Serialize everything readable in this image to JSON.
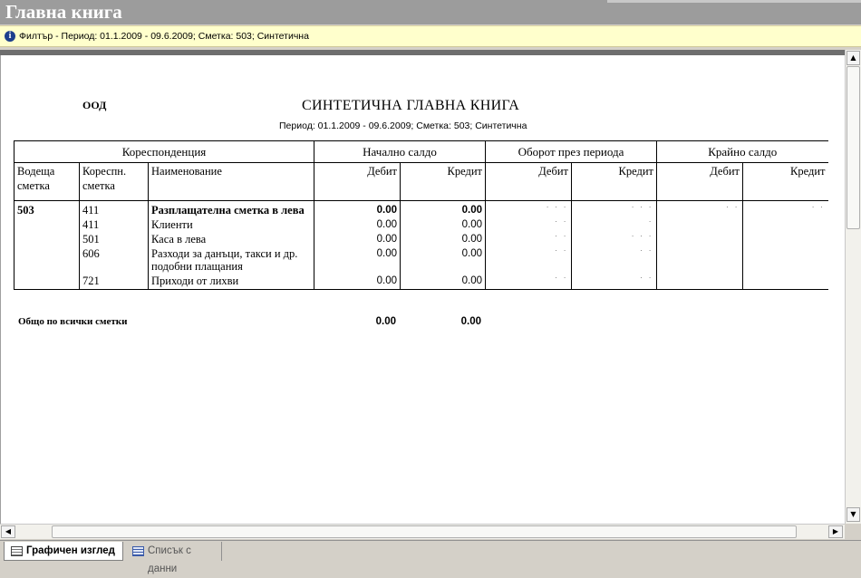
{
  "window": {
    "title": "Главна книга"
  },
  "filter": {
    "text": "Филтър - Период: 01.1.2009 - 09.6.2009; Сметка: 503; Синтетична"
  },
  "report": {
    "company": "ООД",
    "title": "СИНТЕТИЧНА ГЛАВНА КНИГА",
    "subtitle": "Период: 01.1.2009 - 09.6.2009; Сметка: 503; Синтетична",
    "group_headers": {
      "correspondence": "Кореспонденция",
      "opening_balance": "Начално салдо",
      "turnover": "Оборот през периода",
      "closing_balance": "Крайно салдо"
    },
    "columns": {
      "lead_account": "Водеща сметка",
      "corr_account": "Кореспн. сметка",
      "name": "Наименование",
      "debit": "Дебит",
      "credit": "Кредит"
    },
    "rows": [
      {
        "lead": "503",
        "corr": "411",
        "name": "Разплащателна сметка в лева",
        "bold": true,
        "open_debit": "0.00",
        "open_credit": "0.00"
      },
      {
        "lead": "",
        "corr": "411",
        "name": "Клиенти",
        "bold": false,
        "open_debit": "0.00",
        "open_credit": "0.00"
      },
      {
        "lead": "",
        "corr": "501",
        "name": "Каса в лева",
        "bold": false,
        "open_debit": "0.00",
        "open_credit": "0.00"
      },
      {
        "lead": "",
        "corr": "606",
        "name": "Разходи за данъци, такси и др. подобни плащания",
        "bold": false,
        "open_debit": "0.00",
        "open_credit": "0.00"
      },
      {
        "lead": "",
        "corr": "721",
        "name": "Приходи от лихви",
        "bold": false,
        "open_debit": "0.00",
        "open_credit": "0.00"
      }
    ],
    "total": {
      "label": "Общо по всички сметки",
      "open_debit": "0.00",
      "open_credit": "0.00"
    }
  },
  "tabs": [
    {
      "label": "Графичен изглед",
      "active": true
    },
    {
      "label": "Списък с данни",
      "active": false
    }
  ]
}
